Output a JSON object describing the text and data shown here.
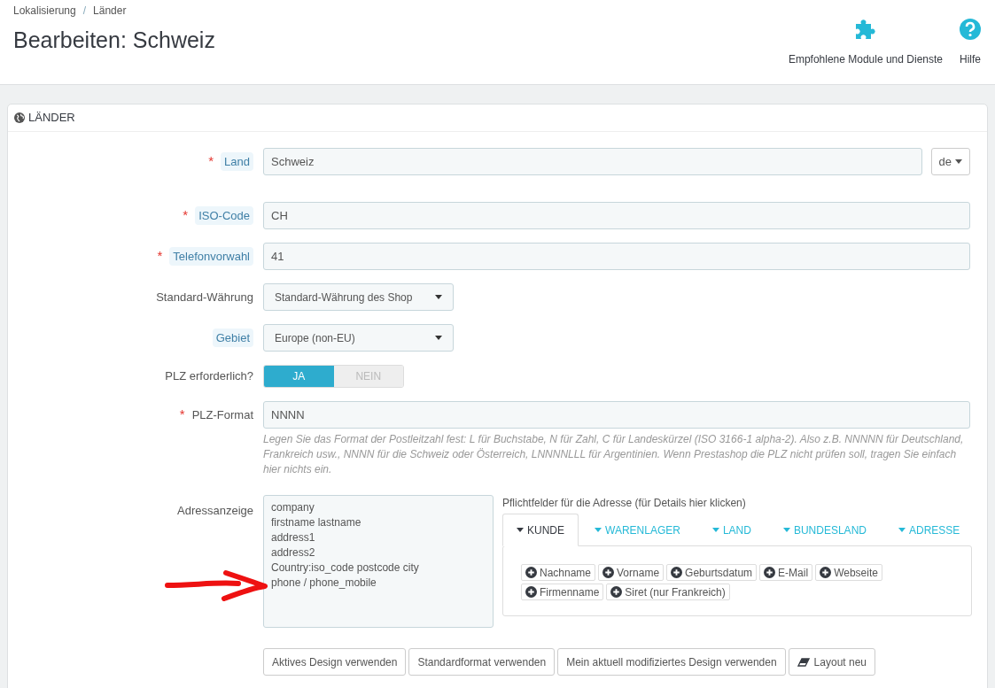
{
  "breadcrumb": [
    "Lokalisierung",
    "Länder"
  ],
  "breadcrumb_separator": "/",
  "required_mark": "*",
  "title": "Bearbeiten: Schweiz",
  "toolbar": [
    {
      "kind": "puzzle",
      "label": "Empfohlene Module und Dienste"
    },
    {
      "kind": "help",
      "label": "Hilfe"
    }
  ],
  "panel": {
    "title": "LÄNDER"
  },
  "fields": [
    {
      "kind": "text",
      "label": "Land",
      "required": true,
      "help": true,
      "value": "Schweiz",
      "lang": "de"
    },
    {
      "kind": "text",
      "label": "ISO-Code",
      "required": true,
      "help": true,
      "value": "CH"
    },
    {
      "kind": "text",
      "label": "Telefonvorwahl",
      "required": true,
      "help": true,
      "value": "41"
    },
    {
      "kind": "select",
      "label": "Standard-Währung",
      "required": false,
      "help": false,
      "value": "Standard-Währung des Shop"
    },
    {
      "kind": "select",
      "label": "Gebiet",
      "required": false,
      "help": true,
      "value": "Europe (non-EU)"
    },
    {
      "kind": "switch",
      "label": "PLZ erforderlich?",
      "required": false,
      "help": false,
      "options": [
        {
          "label": "JA",
          "selected": true
        },
        {
          "label": "NEIN",
          "selected": false
        }
      ]
    },
    {
      "kind": "text",
      "label": "PLZ-Format",
      "required": true,
      "help": false,
      "value": "NNNN",
      "description": "Legen Sie das Format der Postleitzahl fest: L für Buchstabe, N für Zahl, C für Landeskürzel (ISO 3166-1 alpha-2). Also z.B. NNNNN für Deutschland, Frankreich usw., NNNN für die Schweiz oder Österreich, LNNNNLLL für Argentinien. Wenn Prestashop die PLZ nicht prüfen soll, tragen Sie einfach hier nichts ein."
    }
  ],
  "address": {
    "label": "Adressanzeige",
    "lines": [
      "company",
      "firstname lastname",
      "address1",
      "address2",
      "Country:iso_code postcode city",
      "phone / phone_mobile"
    ],
    "fields_title": "Pflichtfelder für die Adresse (für Details hier klicken)",
    "tabs": [
      {
        "label": "KUNDE",
        "selected": true
      },
      {
        "label": "WARENLAGER",
        "selected": false
      },
      {
        "label": "LAND",
        "selected": false
      },
      {
        "label": "BUNDESLAND",
        "selected": false
      },
      {
        "label": "ADRESSE",
        "selected": false
      }
    ],
    "chips": [
      "Nachname",
      "Vorname",
      "Geburtsdatum",
      "E-Mail",
      "Webseite",
      "Firmenname",
      "Siret (nur Frankreich)"
    ],
    "buttons": [
      {
        "kind": "plain",
        "label": "Aktives Design verwenden"
      },
      {
        "kind": "plain",
        "label": "Standardformat verwenden"
      },
      {
        "kind": "plain",
        "label": "Mein aktuell modifiziertes Design verwenden"
      },
      {
        "kind": "eraser",
        "label": "Layout neu"
      }
    ]
  }
}
